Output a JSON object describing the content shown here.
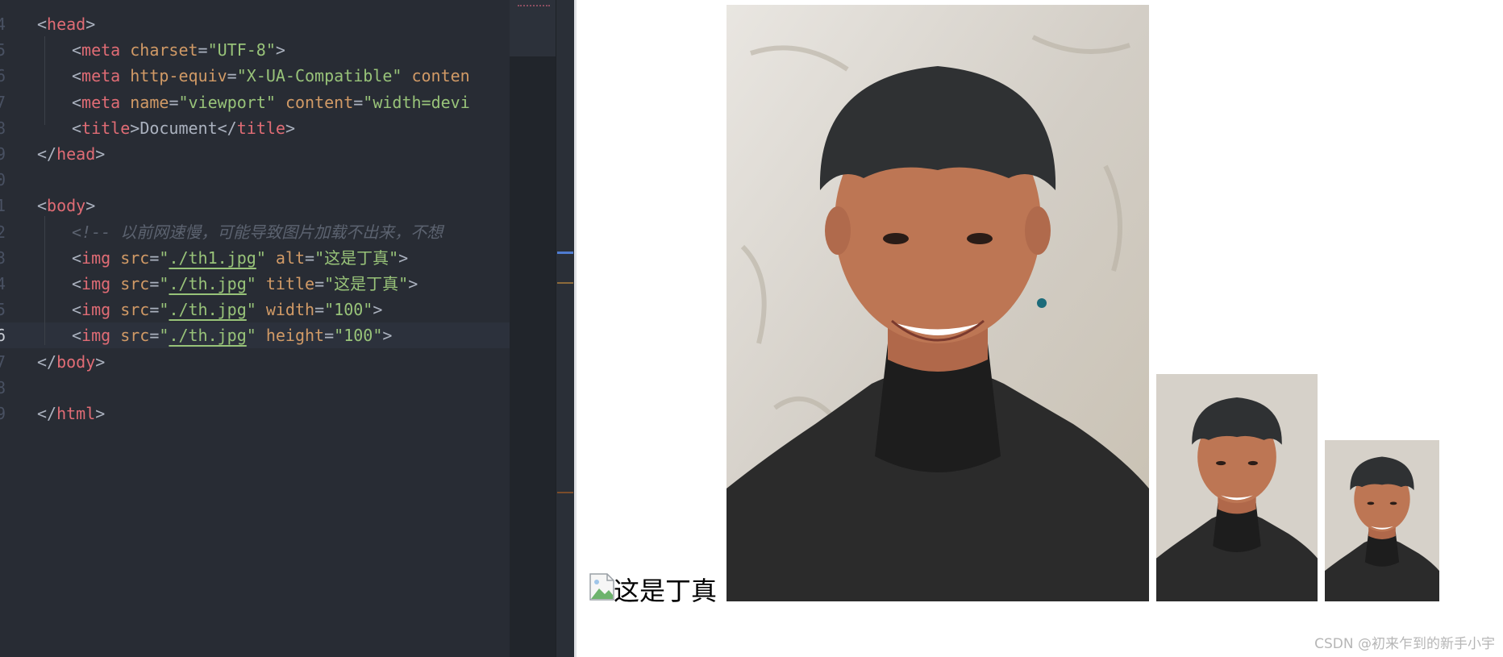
{
  "editor": {
    "lines": [
      {
        "num": "4",
        "tokens": [
          {
            "t": "<",
            "c": "punct"
          },
          {
            "t": "head",
            "c": "tag"
          },
          {
            "t": ">",
            "c": "punct"
          }
        ]
      },
      {
        "num": "5",
        "tokens": [
          {
            "t": "<",
            "c": "punct"
          },
          {
            "t": "meta",
            "c": "tag"
          },
          {
            "t": " charset",
            "c": "attr"
          },
          {
            "t": "=",
            "c": "punct"
          },
          {
            "t": "\"UTF-8\"",
            "c": "str"
          },
          {
            "t": ">",
            "c": "punct"
          }
        ]
      },
      {
        "num": "6",
        "tokens": [
          {
            "t": "<",
            "c": "punct"
          },
          {
            "t": "meta",
            "c": "tag"
          },
          {
            "t": " http-equiv",
            "c": "attr"
          },
          {
            "t": "=",
            "c": "punct"
          },
          {
            "t": "\"X-UA-Compatible\"",
            "c": "str"
          },
          {
            "t": " conten",
            "c": "attr"
          }
        ]
      },
      {
        "num": "7",
        "tokens": [
          {
            "t": "<",
            "c": "punct"
          },
          {
            "t": "meta",
            "c": "tag"
          },
          {
            "t": " name",
            "c": "attr"
          },
          {
            "t": "=",
            "c": "punct"
          },
          {
            "t": "\"viewport\"",
            "c": "str"
          },
          {
            "t": " content",
            "c": "attr"
          },
          {
            "t": "=",
            "c": "punct"
          },
          {
            "t": "\"width=devi",
            "c": "str"
          }
        ]
      },
      {
        "num": "8",
        "tokens": [
          {
            "t": "<",
            "c": "punct"
          },
          {
            "t": "title",
            "c": "tag"
          },
          {
            "t": ">",
            "c": "punct"
          },
          {
            "t": "Document",
            "c": "text"
          },
          {
            "t": "</",
            "c": "punct"
          },
          {
            "t": "title",
            "c": "tag"
          },
          {
            "t": ">",
            "c": "punct"
          }
        ]
      },
      {
        "num": "9",
        "tokens": [
          {
            "t": "</",
            "c": "punct"
          },
          {
            "t": "head",
            "c": "tag"
          },
          {
            "t": ">",
            "c": "punct"
          }
        ]
      },
      {
        "num": "0",
        "tokens": []
      },
      {
        "num": "1",
        "tokens": [
          {
            "t": "<",
            "c": "punct"
          },
          {
            "t": "body",
            "c": "tag"
          },
          {
            "t": ">",
            "c": "punct"
          }
        ]
      },
      {
        "num": "2",
        "tokens": [
          {
            "t": "<!-- 以前网速慢，可能导致图片加载不出来，不想",
            "c": "cmt"
          }
        ]
      },
      {
        "num": "3",
        "tokens": [
          {
            "t": "<",
            "c": "punct"
          },
          {
            "t": "img",
            "c": "tag"
          },
          {
            "t": " src",
            "c": "attr"
          },
          {
            "t": "=",
            "c": "punct"
          },
          {
            "t": "\"",
            "c": "str"
          },
          {
            "t": "./th1.jpg",
            "c": "link"
          },
          {
            "t": "\"",
            "c": "str"
          },
          {
            "t": " alt",
            "c": "attr"
          },
          {
            "t": "=",
            "c": "punct"
          },
          {
            "t": "\"这是丁真\"",
            "c": "str"
          },
          {
            "t": ">",
            "c": "punct"
          }
        ]
      },
      {
        "num": "4",
        "tokens": [
          {
            "t": "<",
            "c": "punct"
          },
          {
            "t": "img",
            "c": "tag"
          },
          {
            "t": " src",
            "c": "attr"
          },
          {
            "t": "=",
            "c": "punct"
          },
          {
            "t": "\"",
            "c": "str"
          },
          {
            "t": "./th.jpg",
            "c": "link"
          },
          {
            "t": "\"",
            "c": "str"
          },
          {
            "t": " title",
            "c": "attr"
          },
          {
            "t": "=",
            "c": "punct"
          },
          {
            "t": "\"这是丁真\"",
            "c": "str"
          },
          {
            "t": ">",
            "c": "punct"
          }
        ]
      },
      {
        "num": "5",
        "tokens": [
          {
            "t": "<",
            "c": "punct"
          },
          {
            "t": "img",
            "c": "tag"
          },
          {
            "t": " src",
            "c": "attr"
          },
          {
            "t": "=",
            "c": "punct"
          },
          {
            "t": "\"",
            "c": "str"
          },
          {
            "t": "./th.jpg",
            "c": "link"
          },
          {
            "t": "\"",
            "c": "str"
          },
          {
            "t": " width",
            "c": "attr"
          },
          {
            "t": "=",
            "c": "punct"
          },
          {
            "t": "\"100\"",
            "c": "str"
          },
          {
            "t": ">",
            "c": "punct"
          }
        ]
      },
      {
        "num": "6",
        "active": true,
        "tokens": [
          {
            "t": "<",
            "c": "punct"
          },
          {
            "t": "img",
            "c": "tag"
          },
          {
            "t": " src",
            "c": "attr"
          },
          {
            "t": "=",
            "c": "punct"
          },
          {
            "t": "\"",
            "c": "str"
          },
          {
            "t": "./th.jpg",
            "c": "link"
          },
          {
            "t": "\"",
            "c": "str"
          },
          {
            "t": " height",
            "c": "attr"
          },
          {
            "t": "=",
            "c": "punct"
          },
          {
            "t": "\"100\"",
            "c": "str"
          },
          {
            "t": ">",
            "c": "punct"
          }
        ]
      },
      {
        "num": "7",
        "tokens": [
          {
            "t": "</",
            "c": "punct"
          },
          {
            "t": "body",
            "c": "tag"
          },
          {
            "t": ">",
            "c": "punct"
          }
        ]
      },
      {
        "num": "8",
        "tokens": []
      },
      {
        "num": "9",
        "tokens": [
          {
            "t": "</",
            "c": "punct"
          },
          {
            "t": "html",
            "c": "tag"
          },
          {
            "t": ">",
            "c": "punct"
          }
        ]
      }
    ]
  },
  "preview": {
    "broken_image_alt": "这是丁真",
    "watermark": "CSDN @初来乍到的新手小宇"
  }
}
